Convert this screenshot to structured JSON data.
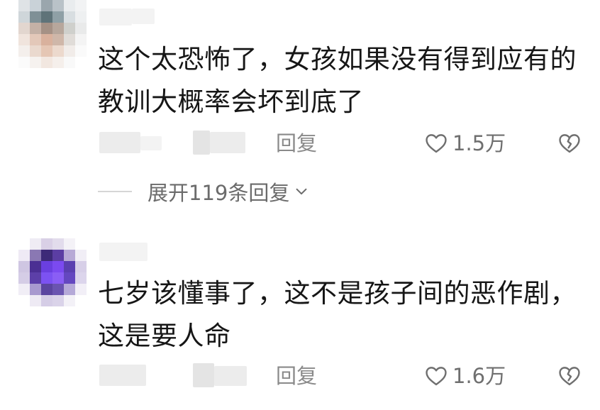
{
  "comments": [
    {
      "text": "这个太恐怖了，女孩如果没有得到应有的教训大概率会坏到底了",
      "reply_label": "回复",
      "like_count": "1.5万",
      "like_icon": "heart-outline-icon",
      "dislike_icon": "broken-heart-icon",
      "expand_label": "展开119条回复",
      "expand_icon": "chevron-down-icon",
      "avatar_colors": [
        "#dfe3e6",
        "#c9d2d8",
        "#9aa6ad",
        "#b9c2c8",
        "#e9ecee",
        "#f2f3f4",
        "#cfd6da",
        "#7f9096",
        "#5f7379",
        "#8fa0a6",
        "#d8dee1",
        "#eef0f1",
        "#e2d6cf",
        "#c4b1a6",
        "#a59185",
        "#b7a79c",
        "#cfd0cc",
        "#e9eaea",
        "#f0e4dd",
        "#e3c8b9",
        "#d9b19d",
        "#cfb7a9",
        "#e0dcd8",
        "#f4f4f4",
        "#f4efec",
        "#ead9ce",
        "#e5c6b4",
        "#ecd9cd",
        "#f1ece9",
        "#fafafa",
        "#fbfbfb",
        "#f6f2ef",
        "#f2e7e0",
        "#f5efeb",
        "#f9f9f9",
        "#ffffff"
      ]
    },
    {
      "text": "七岁该懂事了，这不是孩子间的恶作剧，这是要人命",
      "reply_label": "回复",
      "like_count": "1.6万",
      "like_icon": "heart-outline-icon",
      "dislike_icon": "broken-heart-icon",
      "avatar_colors": [
        "#ffffff",
        "#efecf4",
        "#d9d0e6",
        "#e2dcec",
        "#f4f2f7",
        "#ffffff",
        "#efeaf5",
        "#8a78b3",
        "#3d2a78",
        "#5b3ea3",
        "#b7a9d6",
        "#f1eef6",
        "#cfc6e2",
        "#4b2f93",
        "#6a3fe0",
        "#7b4af0",
        "#5a3fb0",
        "#d7cfe8",
        "#d5cde6",
        "#5c3fa8",
        "#7c52f2",
        "#8a5ef5",
        "#6447c0",
        "#dcd5ec",
        "#f1eef6",
        "#a899cf",
        "#5b45a0",
        "#6a54b0",
        "#b5a9d8",
        "#f2eff7",
        "#ffffff",
        "#eeeaf4",
        "#d5cde6",
        "#dad3e9",
        "#f3f1f7",
        "#ffffff"
      ]
    }
  ]
}
